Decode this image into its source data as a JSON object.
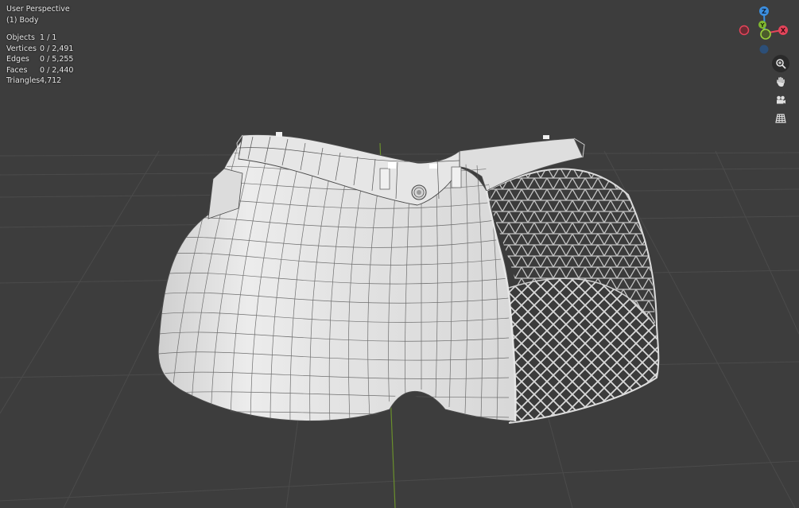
{
  "viewport": {
    "view_name": "User Perspective",
    "object_name": "(1) Body"
  },
  "stats": [
    {
      "label": "Objects",
      "value": "1 / 1"
    },
    {
      "label": "Vertices",
      "value": "0 / 2,491"
    },
    {
      "label": "Edges",
      "value": "0 / 5,255"
    },
    {
      "label": "Faces",
      "value": "0 / 2,440"
    },
    {
      "label": "Triangles",
      "value": "4,712"
    }
  ],
  "gizmo": {
    "axis_z": "Z",
    "axis_y": "Y",
    "axis_x": "X",
    "colors": {
      "x": "#e4445a",
      "y": "#7fb82f",
      "z": "#3b8fe0"
    }
  },
  "nav_tools": [
    {
      "name": "zoom-icon"
    },
    {
      "name": "pan-hand-icon"
    },
    {
      "name": "camera-icon"
    },
    {
      "name": "grid-ortho-icon"
    }
  ],
  "colors": {
    "background": "#3d3d3d",
    "grid": "#4a4a4a",
    "mesh_fill": "#e4e4e4",
    "wire": "#3a3a3a"
  }
}
